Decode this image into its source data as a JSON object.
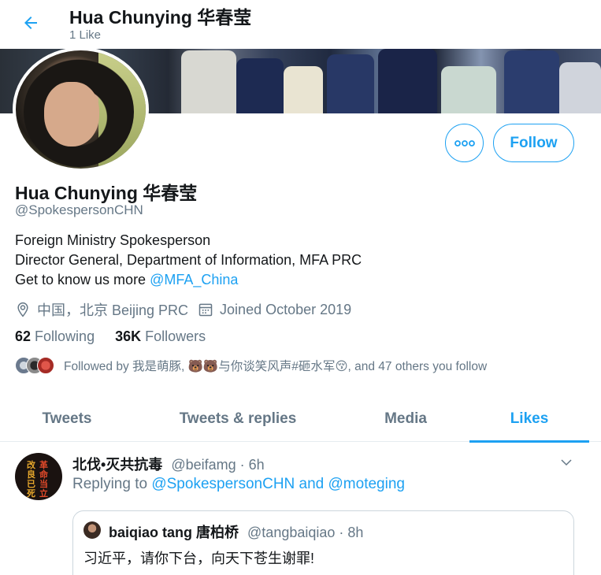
{
  "header": {
    "title": "Hua Chunying 华春莹",
    "subtitle": "1 Like"
  },
  "profile": {
    "name": "Hua Chunying 华春莹",
    "handle": "@SpokespersonCHN",
    "bio_line1": "Foreign Ministry Spokesperson",
    "bio_line2": "Director General, Department of Information, MFA PRC",
    "bio_line3_prefix": "Get to know us more ",
    "bio_link": "@MFA_China",
    "location": "中国，北京 Beijing PRC",
    "joined": "Joined October 2019",
    "following_count": "62",
    "following_label": "Following",
    "followers_count": "36K",
    "followers_label": "Followers",
    "followed_by": "Followed by 我是萌豚, 🐻🐻与你谈笑风声#砸水军😚, and 47 others you follow"
  },
  "actions": {
    "follow_label": "Follow",
    "more_icon": "more-icon"
  },
  "tabs": [
    {
      "label": "Tweets",
      "active": false
    },
    {
      "label": "Tweets & replies",
      "active": false
    },
    {
      "label": "Media",
      "active": false
    },
    {
      "label": "Likes",
      "active": true
    }
  ],
  "tweet": {
    "author": "北伐•灭共抗毒",
    "handle": "@beifamg",
    "time": "6h",
    "replying_prefix": "Replying to ",
    "replying_to": "@SpokespersonCHN and @moteging",
    "avatar_text": [
      "改",
      "良",
      "已",
      "死",
      "革",
      "命",
      "当",
      "立"
    ],
    "quote": {
      "author": "baiqiao tang 唐柏桥",
      "handle": "@tangbaiqiao",
      "time": "8h",
      "text": "习近平，请你下台，向天下苍生谢罪!"
    }
  },
  "colors": {
    "accent": "#1da1f2",
    "muted": "#657786",
    "text": "#14171a",
    "border": "#e6ecf0"
  }
}
